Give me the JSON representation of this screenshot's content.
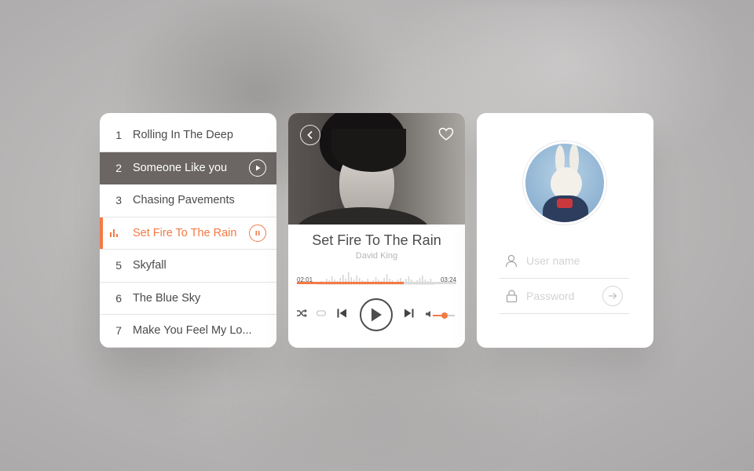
{
  "colors": {
    "accent": "#f37a45",
    "selected_bg": "#6b6663",
    "text": "#4a4a4a"
  },
  "playlist": {
    "items": [
      {
        "num": "1",
        "title": "Rolling In The Deep",
        "state": "normal"
      },
      {
        "num": "2",
        "title": "Someone Like you",
        "state": "selected"
      },
      {
        "num": "3",
        "title": "Chasing Pavements",
        "state": "normal"
      },
      {
        "num": "",
        "title": "Set Fire To The Rain",
        "state": "playing"
      },
      {
        "num": "5",
        "title": "Skyfall",
        "state": "normal"
      },
      {
        "num": "6",
        "title": "The Blue Sky",
        "state": "normal"
      },
      {
        "num": "7",
        "title": "Make You Feel My Lo...",
        "state": "normal"
      }
    ]
  },
  "player": {
    "title": "Set Fire To The Rain",
    "artist": "David King",
    "time_current": "02:01",
    "time_total": "03:24",
    "progress_percent": 67,
    "volume_percent": 58,
    "icons": {
      "back": "chevron-left-icon",
      "favorite": "heart-icon",
      "shuffle": "shuffle-icon",
      "repeat": "repeat-icon",
      "previous": "skip-previous-icon",
      "play": "play-icon",
      "next": "skip-next-icon",
      "volume": "volume-icon"
    }
  },
  "login": {
    "username_placeholder": "User name",
    "password_placeholder": "Password",
    "icons": {
      "user": "user-icon",
      "password": "lock-icon",
      "submit": "arrow-right-icon"
    }
  }
}
